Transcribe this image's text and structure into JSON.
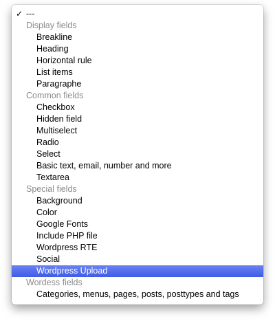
{
  "dropdown": {
    "current": {
      "check_icon": "✓",
      "label": "---"
    },
    "groups": [
      {
        "label": "Display fields",
        "items": [
          "Breakline",
          "Heading",
          "Horizontal rule",
          "List items",
          "Paragraphe"
        ]
      },
      {
        "label": "Common fields",
        "items": [
          "Checkbox",
          "Hidden field",
          "Multiselect",
          "Radio",
          "Select",
          "Basic text, email, number and more",
          "Textarea"
        ]
      },
      {
        "label": "Special fields",
        "items": [
          "Background",
          "Color",
          "Google Fonts",
          "Include PHP file",
          "Wordpress RTE",
          "Social",
          "Wordpress Upload"
        ]
      },
      {
        "label": "Wordess fields",
        "items": [
          "Categories, menus, pages, posts, posttypes and tags"
        ]
      }
    ],
    "highlighted_item": "Wordpress Upload",
    "colors": {
      "highlight": "#4a66ea",
      "group_label": "#8a8a8a"
    }
  }
}
